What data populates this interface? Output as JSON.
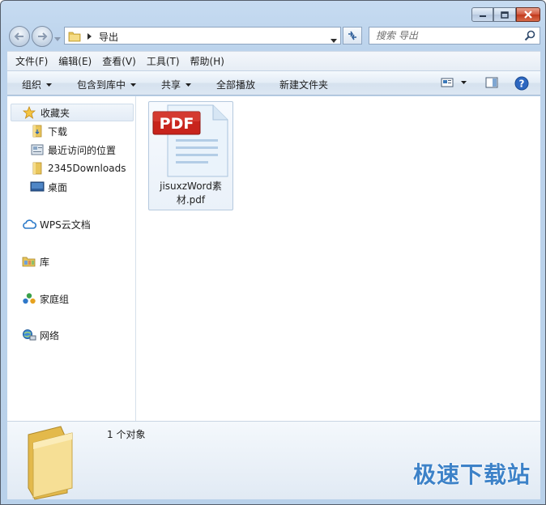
{
  "window": {
    "caption_buttons": [
      "minimize",
      "maximize",
      "close"
    ]
  },
  "address": {
    "path": "导出",
    "search_placeholder": "搜索 导出"
  },
  "menu": [
    "文件(F)",
    "编辑(E)",
    "查看(V)",
    "工具(T)",
    "帮助(H)"
  ],
  "commands": {
    "organize": "组织",
    "include_in_library": "包含到库中",
    "share": "共享",
    "play_all": "全部播放",
    "new_folder": "新建文件夹"
  },
  "nav": {
    "favorites": "收藏夹",
    "favorites_items": [
      "下载",
      "最近访问的位置",
      "2345Downloads",
      "桌面"
    ],
    "wps_cloud": "WPS云文档",
    "libraries": "库",
    "homegroup": "家庭组",
    "network": "网络"
  },
  "files": [
    {
      "name": "jisuxzWord素材.pdf",
      "badge": "PDF"
    }
  ],
  "details": {
    "status": "1 个对象"
  },
  "watermark": "极速下载站",
  "colors": {
    "pdf_red": "#c8241c",
    "accent_blue": "#3d82c8"
  }
}
